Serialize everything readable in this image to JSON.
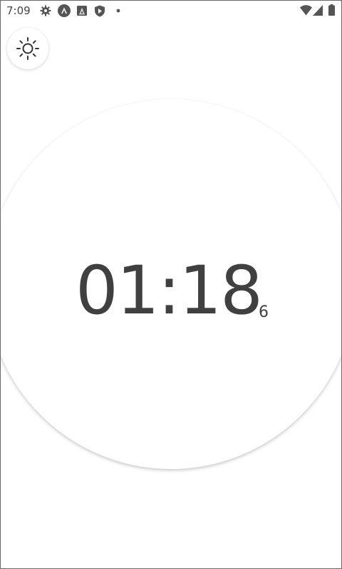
{
  "status_bar": {
    "time": "7:09",
    "left_icons": [
      "settings-icon",
      "app-a-icon",
      "app-box-a-icon",
      "shield-play-icon",
      "dot-icon"
    ],
    "right_icons": [
      "wifi-icon",
      "signal-icon",
      "battery-icon"
    ]
  },
  "theme_toggle": {
    "icon": "sun-icon"
  },
  "timer": {
    "main": "01:18",
    "sub": "6"
  }
}
